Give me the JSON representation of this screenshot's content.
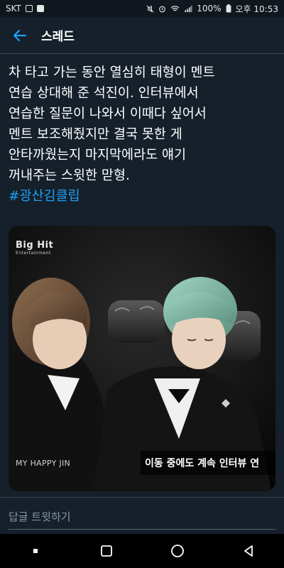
{
  "status_bar": {
    "carrier": "SKT",
    "battery": "100%",
    "time": "오후 10:53"
  },
  "app_bar": {
    "title": "스레드"
  },
  "tweet": {
    "lines": [
      "차 타고 가는 동안 열심히 태형이 멘트",
      "연습 상대해 준 석진이. 인터뷰에서",
      "연습한 질문이 나와서 이때다 싶어서",
      "멘트 보조해줬지만 결국 못한 게",
      "안타까웠는지 마지막에라도 얘기",
      "꺼내주는 스윗한 맏형."
    ],
    "hashtag": "#광산김클립"
  },
  "media": {
    "logo_main": "Big Hit",
    "logo_sub": "Entertainment",
    "watermark": "MY HAPPY JIN",
    "caption": "이동 중에도 계속 인터뷰 연"
  },
  "reply": {
    "placeholder": "답글 트윗하기"
  },
  "colors": {
    "background": "#15202b",
    "accent": "#1da1f2",
    "divider": "#38444d"
  }
}
